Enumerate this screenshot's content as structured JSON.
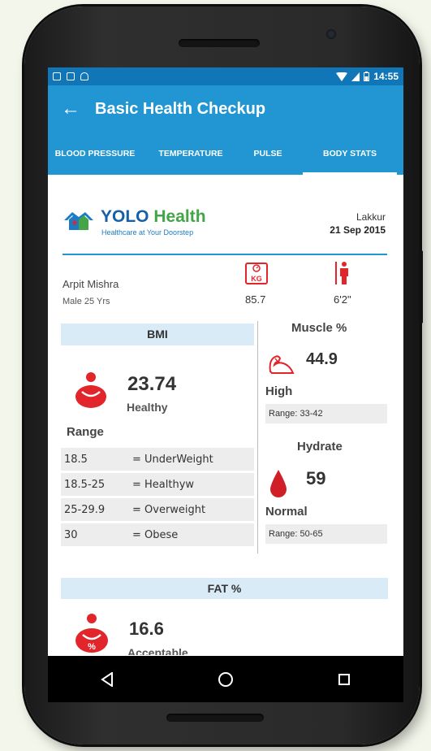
{
  "status_bar": {
    "time": "14:55"
  },
  "app_bar": {
    "title": "Basic Health Checkup"
  },
  "tabs": [
    {
      "label": "BLOOD PRESSURE",
      "active": false
    },
    {
      "label": "TEMPERATURE",
      "active": false
    },
    {
      "label": "PULSE",
      "active": false
    },
    {
      "label": "BODY STATS",
      "active": true
    }
  ],
  "report": {
    "brand_yolo": "YOLO",
    "brand_health": "Health",
    "tagline": "Healthcare at Your Doorstep",
    "location": "Lakkur",
    "date": "21 Sep 2015"
  },
  "patient": {
    "name": "Arpit Mishra",
    "demographics": "Male   25 Yrs",
    "weight_icon_text": "KG",
    "weight": "85.7",
    "height": "6'2\""
  },
  "bmi": {
    "heading": "BMI",
    "value": "23.74",
    "category": "Healthy",
    "range_label": "Range",
    "ranges": [
      {
        "range": "18.5",
        "label": "= UnderWeight"
      },
      {
        "range": "18.5-25",
        "label": "= Healthyw"
      },
      {
        "range": "25-29.9",
        "label": "= Overweight"
      },
      {
        "range": "30",
        "label": "= Obese"
      }
    ]
  },
  "muscle": {
    "title": "Muscle %",
    "value": "44.9",
    "category": "High",
    "range": "Range: 33-42"
  },
  "hydrate": {
    "title": "Hydrate",
    "value": "59",
    "category": "Normal",
    "range": "Range: 50-65"
  },
  "fat": {
    "heading": "FAT %",
    "icon_text": "%",
    "value": "16.6",
    "category": "Acceptable"
  },
  "colors": {
    "primary": "#2196d3",
    "status_bar": "#1176b8",
    "accent_red": "#e2252b",
    "section_header": "#d8ebf7",
    "row_bg": "#ededed"
  },
  "icons": {
    "back": "arrow-left-icon",
    "weight": "weighing-scale-icon",
    "height": "person-height-icon",
    "bmi": "person-icon",
    "muscle": "flexed-arm-icon",
    "hydrate": "water-drop-icon",
    "nav_back": "triangle-back-icon",
    "nav_home": "circle-home-icon",
    "nav_recents": "square-recents-icon"
  }
}
